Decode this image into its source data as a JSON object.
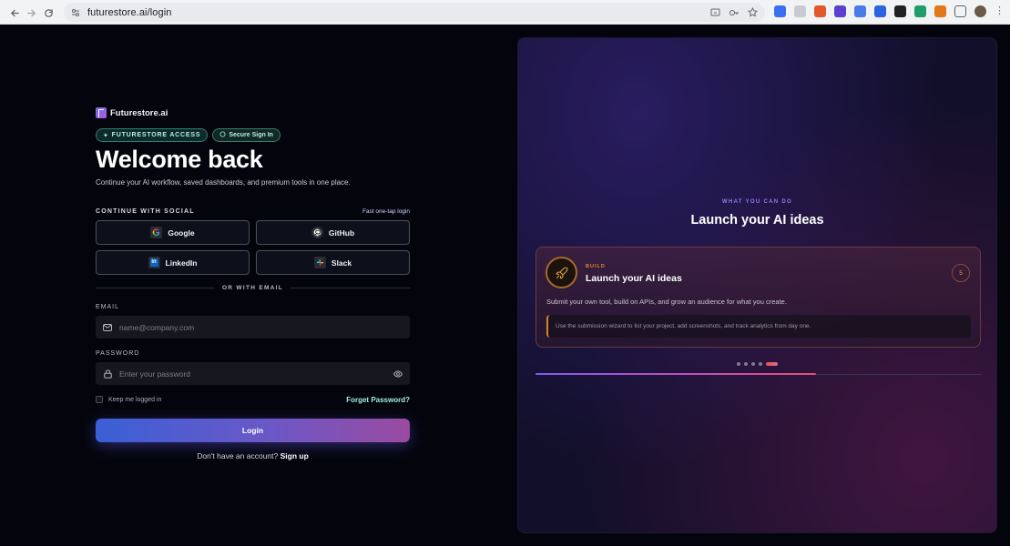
{
  "browser": {
    "url": "futurestore.ai/login"
  },
  "brand": {
    "name": "Futurestore.ai"
  },
  "badges": {
    "access": "FUTURESTORE ACCESS",
    "secure": "Secure Sign In"
  },
  "hero": {
    "title": "Welcome back",
    "subtitle": "Continue your AI workflow, saved dashboards, and premium tools in one place."
  },
  "social": {
    "label": "CONTINUE WITH SOCIAL",
    "fast": "Fast one-tap login",
    "buttons": [
      {
        "label": "Google",
        "icon": "google-icon"
      },
      {
        "label": "GitHub",
        "icon": "github-icon"
      },
      {
        "label": "LinkedIn",
        "icon": "linkedin-icon"
      },
      {
        "label": "Slack",
        "icon": "slack-icon"
      }
    ]
  },
  "divider": "OR WITH EMAIL",
  "form": {
    "email_label": "EMAIL",
    "email_placeholder": "name@company.com",
    "password_label": "PASSWORD",
    "password_placeholder": "Enter your password",
    "remember_label": "Keep me logged in",
    "forgot_label": "Forget Password?",
    "login_label": "Login",
    "signup_prompt": "Don't have an account?",
    "signup_link": "Sign up"
  },
  "showcase": {
    "eyebrow": "WHAT YOU CAN DO",
    "title": "Launch your AI ideas",
    "card": {
      "eyebrow": "BUILD",
      "title": "Launch your AI ideas",
      "number": "5",
      "description": "Submit your own tool, build on APIs, and grow an audience for what you create.",
      "tip": "Use the submission wizard to list your project, add screenshots, and track analytics from day one."
    },
    "slide_count": 5,
    "active_slide": 5,
    "progress_fraction": 0.63
  },
  "colors": {
    "accent_teal": "#9ff0df",
    "login_gradient_start": "#3a5fd6",
    "login_gradient_end": "#9a4ba0",
    "card_accent": "#e08a3a"
  }
}
